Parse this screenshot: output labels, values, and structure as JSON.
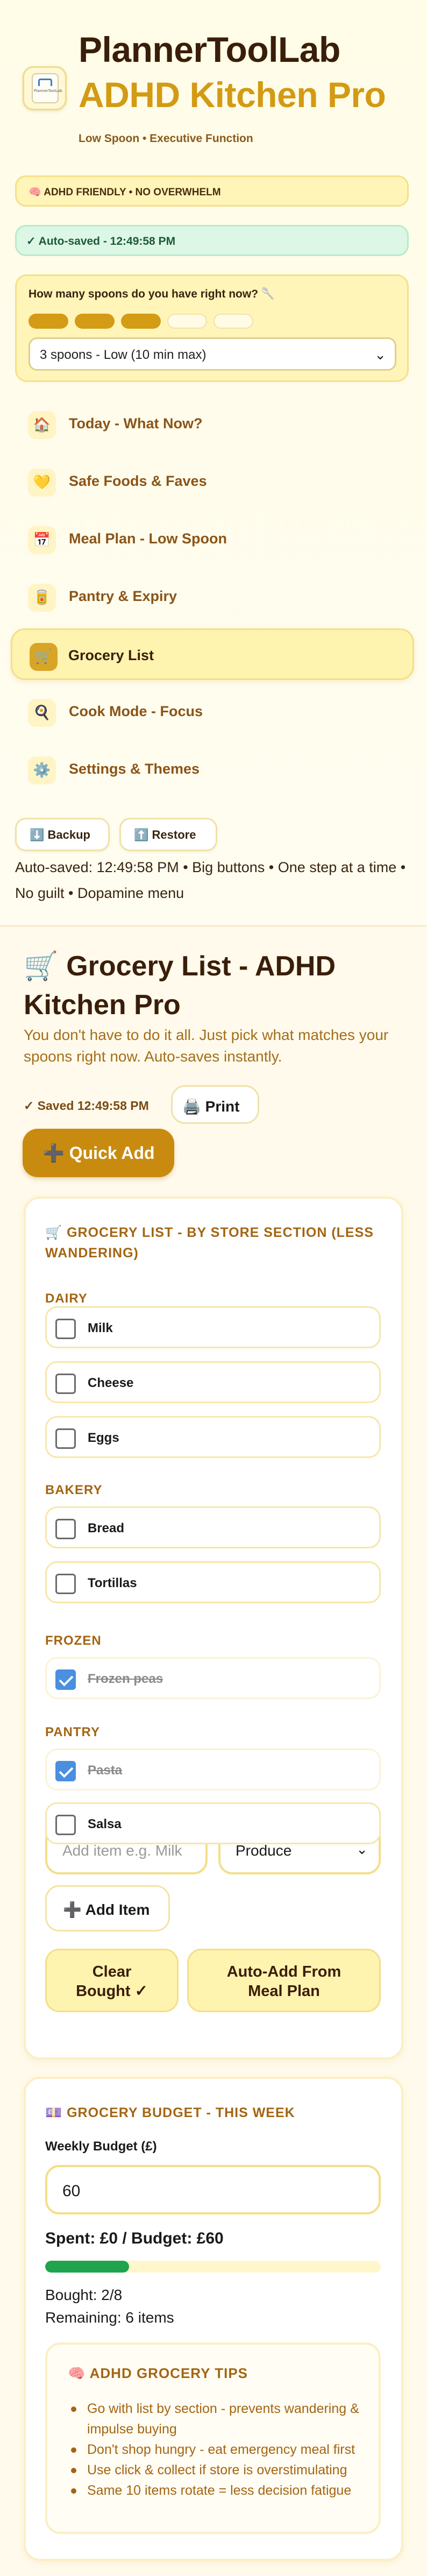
{
  "brand": {
    "title": "PlannerToolLab",
    "subtitle": "ADHD Kitchen Pro",
    "tagline": "Low Spoon • Executive Function",
    "logo_text": "PlannerToolLab"
  },
  "badges": {
    "adhd": "🧠 ADHD FRIENDLY • NO OVERWHELM",
    "autosave": "✓ Auto-saved - 12:49:58 PM"
  },
  "spoons": {
    "question": "How many spoons do you have right now? 🥄",
    "level": 3,
    "max": 5,
    "selected": "3 spoons - Low (10 min max)",
    "colors": {
      "filled": "#d49b15",
      "empty": "#fffbe6"
    }
  },
  "nav": {
    "items": [
      {
        "icon": "🏠",
        "icon_name": "house-icon",
        "label": "Today - What Now?",
        "active": false
      },
      {
        "icon": "💛",
        "icon_name": "yellow-heart-icon",
        "label": "Safe Foods & Faves",
        "active": false
      },
      {
        "icon": "📅",
        "icon_name": "calendar-icon",
        "label": "Meal Plan - Low Spoon",
        "active": false
      },
      {
        "icon": "🥫",
        "icon_name": "canned-food-icon",
        "label": "Pantry & Expiry",
        "active": false
      },
      {
        "icon": "🛒",
        "icon_name": "shopping-cart-icon",
        "label": "Grocery List",
        "active": true
      },
      {
        "icon": "🍳",
        "icon_name": "cooking-icon",
        "label": "Cook Mode - Focus",
        "active": false
      },
      {
        "icon": "⚙️",
        "icon_name": "gear-icon",
        "label": "Settings & Themes",
        "active": false
      }
    ]
  },
  "actions": {
    "backup": "⬇️ Backup",
    "restore": "⬆️ Restore"
  },
  "status_line": "Auto-saved: 12:49:58 PM • Big buttons • One step at a time • No guilt • Dopamine menu",
  "main": {
    "title": "🛒 Grocery List - ADHD Kitchen Pro",
    "subtitle": "You don't have to do it all. Just pick what matches your spoons right now. Auto-saves instantly.",
    "saved": "✓ Saved 12:49:58 PM",
    "print": "🖨️ Print",
    "quick_add": "➕ Quick Add"
  },
  "grocery": {
    "heading": "🛒 GROCERY LIST - BY STORE SECTION (LESS WANDERING)",
    "sections": [
      {
        "name": "DAIRY",
        "items": [
          {
            "label": "Milk",
            "checked": false
          },
          {
            "label": "Cheese",
            "checked": false
          },
          {
            "label": "Eggs",
            "checked": false
          }
        ]
      },
      {
        "name": "BAKERY",
        "items": [
          {
            "label": "Bread",
            "checked": false
          },
          {
            "label": "Tortillas",
            "checked": false
          }
        ]
      },
      {
        "name": "FROZEN",
        "items": [
          {
            "label": "Frozen peas",
            "checked": true
          }
        ]
      },
      {
        "name": "PANTRY",
        "items": [
          {
            "label": "Pasta",
            "checked": true
          },
          {
            "label": "Salsa",
            "checked": false
          }
        ]
      }
    ],
    "add_placeholder": "Add item e.g. Milk",
    "section_selected": "Produce",
    "add_button": "➕ Add Item",
    "clear_button": "Clear Bought ✓",
    "auto_add_button": "Auto-Add From Meal Plan"
  },
  "budget": {
    "heading": "💷 GROCERY BUDGET - THIS WEEK",
    "label": "Weekly Budget (£)",
    "value": "60",
    "spent_text": "Spent: £0 / Budget: £60",
    "progress_fraction": 0.25,
    "progress_color": "#1fa34d",
    "bought": "Bought: 2/8",
    "remaining": "Remaining: 6 items"
  },
  "tips": {
    "heading": "🧠 ADHD GROCERY TIPS",
    "items": [
      "Go with list by section - prevents wandering & impulse buying",
      "Don't shop hungry - eat emergency meal first",
      "Use click & collect if store is overstimulating",
      "Same 10 items rotate = less decision fatigue"
    ]
  }
}
